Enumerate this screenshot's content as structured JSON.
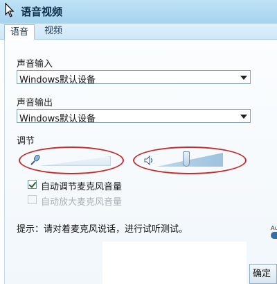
{
  "window": {
    "title": "语音视频"
  },
  "tabs": [
    {
      "label": "语音",
      "active": true
    },
    {
      "label": "视频",
      "active": false
    }
  ],
  "input": {
    "label": "声音输入",
    "selected": "Windows默认设备"
  },
  "output": {
    "label": "声音输出",
    "selected": "Windows默认设备"
  },
  "adjust": {
    "label": "调节",
    "mic_level": 0,
    "speaker_level": 0.45
  },
  "options": {
    "auto_adjust_mic": {
      "label": "自动调节麦克风音量",
      "checked": true,
      "enabled": true
    },
    "auto_amplify_mic": {
      "label": "自动放大麦克风音量",
      "checked": false,
      "enabled": false
    }
  },
  "hint": "提示：请对着麦克风说话，进行试听测试。",
  "buttons": {
    "ok": "确定"
  },
  "edge": {
    "text": "Au"
  },
  "colors": {
    "titlebar": "#a6d3ef",
    "highlight_oval": "#c62a2a"
  },
  "icons": {
    "title": "cursor-arrow-icon",
    "mic": "microphone-icon",
    "speaker": "speaker-icon"
  }
}
